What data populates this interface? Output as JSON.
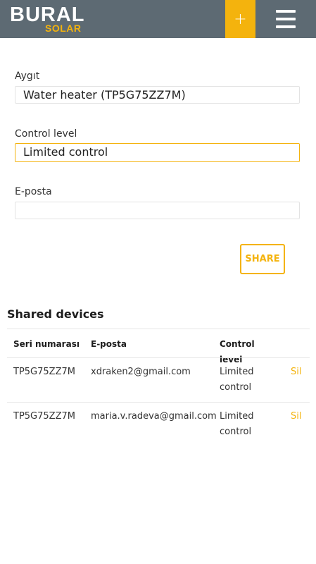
{
  "header": {
    "logo_main": "BURAL",
    "logo_sub": "SOLAR",
    "add_label": "+"
  },
  "form": {
    "device_label": "Aygıt",
    "device_value": "Water heater (TP5G75ZZ7M)",
    "control_label": "Control level",
    "control_value": "Limited control",
    "email_label": "E-posta",
    "email_value": "",
    "share_label": "SHARE"
  },
  "shared": {
    "title": "Shared devices",
    "columns": [
      "Seri numarası",
      "E-posta",
      "Control level"
    ],
    "rows": [
      {
        "serial": "TP5G75ZZ7M",
        "email": "xdraken2@gmail.com",
        "level": "Limited control",
        "action": "Sil"
      },
      {
        "serial": "TP5G75ZZ7M",
        "email": "maria.v.radeva@gmail.com",
        "level": "Limited control",
        "action": "Sil"
      }
    ]
  },
  "colors": {
    "header_bg": "#5d6a73",
    "accent": "#f4b30d"
  },
  "icons": {
    "add": "plus-icon",
    "menu": "hamburger-menu-icon"
  }
}
